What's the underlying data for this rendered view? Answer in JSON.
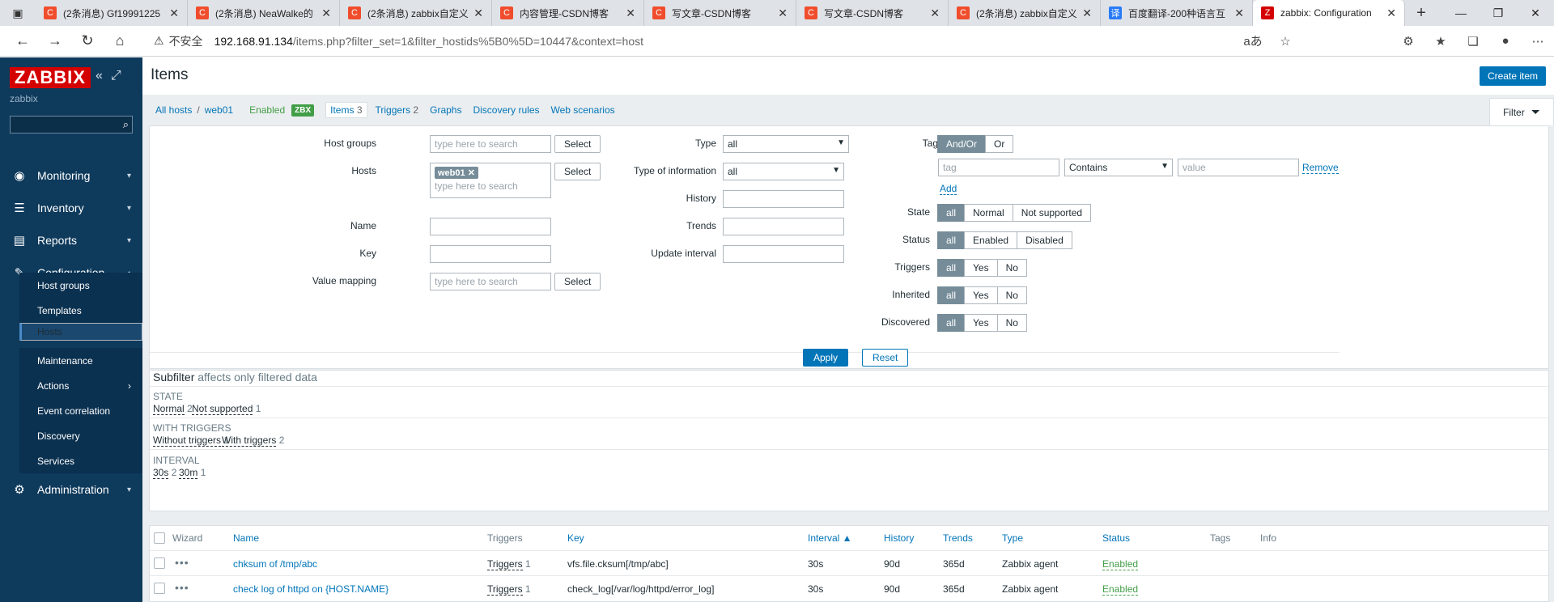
{
  "browser": {
    "tabs": [
      {
        "title": "(2条消息) Gf19991225",
        "icon": "C",
        "color": "#f04d2c"
      },
      {
        "title": "(2条消息) NeaWalke的",
        "icon": "C",
        "color": "#f04d2c"
      },
      {
        "title": "(2条消息) zabbix自定义",
        "icon": "C",
        "color": "#f04d2c"
      },
      {
        "title": "内容管理-CSDN博客",
        "icon": "C",
        "color": "#f04d2c"
      },
      {
        "title": "写文章-CSDN博客",
        "icon": "C",
        "color": "#f04d2c"
      },
      {
        "title": "写文章-CSDN博客",
        "icon": "C",
        "color": "#f04d2c"
      },
      {
        "title": "(2条消息) zabbix自定义",
        "icon": "C",
        "color": "#f04d2c"
      },
      {
        "title": "百度翻译-200种语言互",
        "icon": "译",
        "color": "#2a7cf6"
      },
      {
        "title": "zabbix: Configuration",
        "icon": "Z",
        "color": "#d40000"
      }
    ],
    "new_tab": "+",
    "window_controls": [
      "—",
      "❐",
      "✕"
    ],
    "url_security": "不安全",
    "url_host": "192.168.91.134",
    "url_path": "/items.php?filter_set=1&filter_hostids%5B0%5D=10447&context=host",
    "read_aloud": "aあ"
  },
  "sidebar": {
    "logo": "ZABBIX",
    "subtitle": "zabbix",
    "menu": {
      "monitoring": "Monitoring",
      "inventory": "Inventory",
      "reports": "Reports",
      "configuration": "Configuration",
      "administration": "Administration"
    },
    "submenu": [
      "Host groups",
      "Templates",
      "Hosts",
      "Maintenance",
      "Actions",
      "Event correlation",
      "Discovery",
      "Services"
    ]
  },
  "page": {
    "title": "Items",
    "create_button": "Create item"
  },
  "nav": {
    "all_hosts": "All hosts",
    "separator": "/",
    "host": "web01",
    "enabled": "Enabled",
    "zbx": "ZBX",
    "items": "Items",
    "items_count": "3",
    "triggers": "Triggers",
    "triggers_count": "2",
    "graphs": "Graphs",
    "discovery": "Discovery rules",
    "web": "Web scenarios",
    "filter_tab": "Filter"
  },
  "filter": {
    "host_groups_label": "Host groups",
    "hosts_label": "Hosts",
    "name_label": "Name",
    "key_label": "Key",
    "value_mapping_label": "Value mapping",
    "search_placeholder": "type here to search",
    "select": "Select",
    "host_chip": "web01",
    "type_label": "Type",
    "type_value": "all",
    "info_label": "Type of information",
    "info_value": "all",
    "history_label": "History",
    "trends_label": "Trends",
    "update_label": "Update interval",
    "tags_label": "Tags",
    "and_or": "And/Or",
    "or": "Or",
    "tag_placeholder": "tag",
    "contains": "Contains",
    "value_placeholder": "value",
    "remove": "Remove",
    "add": "Add",
    "state_label": "State",
    "all": "all",
    "normal": "Normal",
    "not_supported": "Not supported",
    "status_label": "Status",
    "enabled": "Enabled",
    "disabled": "Disabled",
    "triggers_label": "Triggers",
    "inherited_label": "Inherited",
    "discovered_label": "Discovered",
    "yes": "Yes",
    "no": "No",
    "apply": "Apply",
    "reset": "Reset"
  },
  "subfilter": {
    "title": "Subfilter",
    "note": "affects only filtered data",
    "state_h": "STATE",
    "normal": "Normal",
    "normal_c": "2",
    "ns": "Not supported",
    "ns_c": "1",
    "trig_h": "WITH TRIGGERS",
    "without": "Without triggers",
    "without_c": "1",
    "with": "With triggers",
    "with_c": "2",
    "int_h": "INTERVAL",
    "i30s": "30s",
    "i30s_c": "2",
    "i30m": "30m",
    "i30m_c": "1"
  },
  "table": {
    "headers": {
      "wizard": "Wizard",
      "name": "Name",
      "triggers": "Triggers",
      "key": "Key",
      "interval": "Interval ▲",
      "history": "History",
      "trends": "Trends",
      "type": "Type",
      "status": "Status",
      "tags": "Tags",
      "info": "Info"
    },
    "rows": [
      {
        "name": "chksum of /tmp/abc",
        "triggers": "Triggers",
        "tcount": "1",
        "key": "vfs.file.cksum[/tmp/abc]",
        "interval": "30s",
        "history": "90d",
        "trends": "365d",
        "type": "Zabbix agent",
        "status": "Enabled"
      },
      {
        "name": "check log of httpd on {HOST.NAME}",
        "triggers": "Triggers",
        "tcount": "1",
        "key": "check_log[/var/log/httpd/error_log]",
        "interval": "30s",
        "history": "90d",
        "trends": "365d",
        "type": "Zabbix agent",
        "status": "Enabled"
      }
    ]
  }
}
